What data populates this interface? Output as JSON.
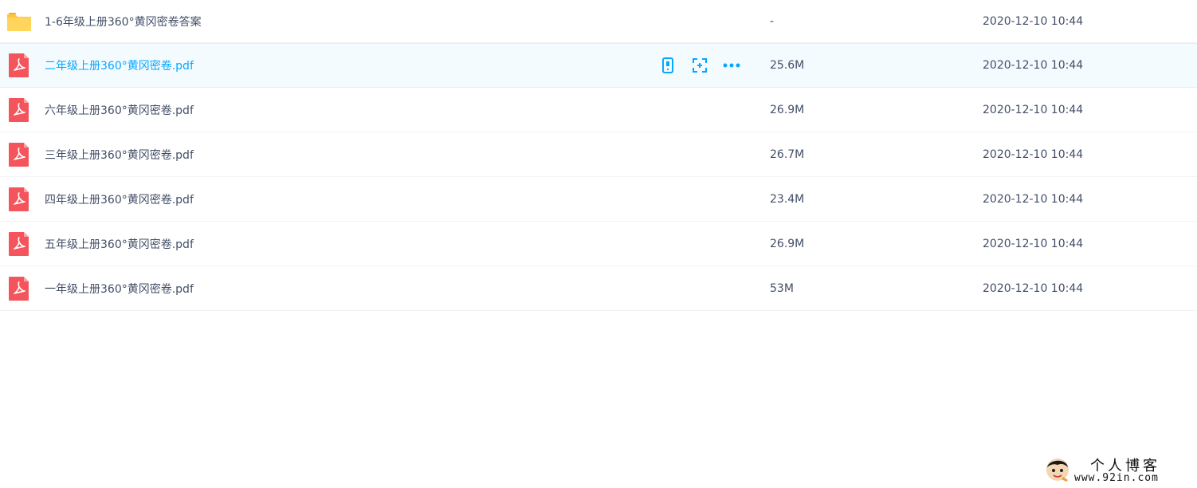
{
  "files": [
    {
      "type": "folder",
      "name": "1-6年级上册360°黄冈密卷答案",
      "size": "-",
      "date": "2020-12-10 10:44",
      "hovered": false
    },
    {
      "type": "pdf",
      "name": "二年级上册360°黄冈密卷.pdf",
      "size": "25.6M",
      "date": "2020-12-10 10:44",
      "hovered": true
    },
    {
      "type": "pdf",
      "name": "六年级上册360°黄冈密卷.pdf",
      "size": "26.9M",
      "date": "2020-12-10 10:44",
      "hovered": false
    },
    {
      "type": "pdf",
      "name": "三年级上册360°黄冈密卷.pdf",
      "size": "26.7M",
      "date": "2020-12-10 10:44",
      "hovered": false
    },
    {
      "type": "pdf",
      "name": "四年级上册360°黄冈密卷.pdf",
      "size": "23.4M",
      "date": "2020-12-10 10:44",
      "hovered": false
    },
    {
      "type": "pdf",
      "name": "五年级上册360°黄冈密卷.pdf",
      "size": "26.9M",
      "date": "2020-12-10 10:44",
      "hovered": false
    },
    {
      "type": "pdf",
      "name": "一年级上册360°黄冈密卷.pdf",
      "size": "53M",
      "date": "2020-12-10 10:44",
      "hovered": false
    }
  ],
  "row_actions": [
    "phone-icon",
    "share-scan-icon",
    "more-icon"
  ],
  "watermark": {
    "title": "个人博客",
    "url": "www.92in.com"
  },
  "colors": {
    "accent": "#06a7ff",
    "pdf_red": "#f4555c",
    "folder_yellow": "#ffd55c",
    "text": "#424e67"
  }
}
